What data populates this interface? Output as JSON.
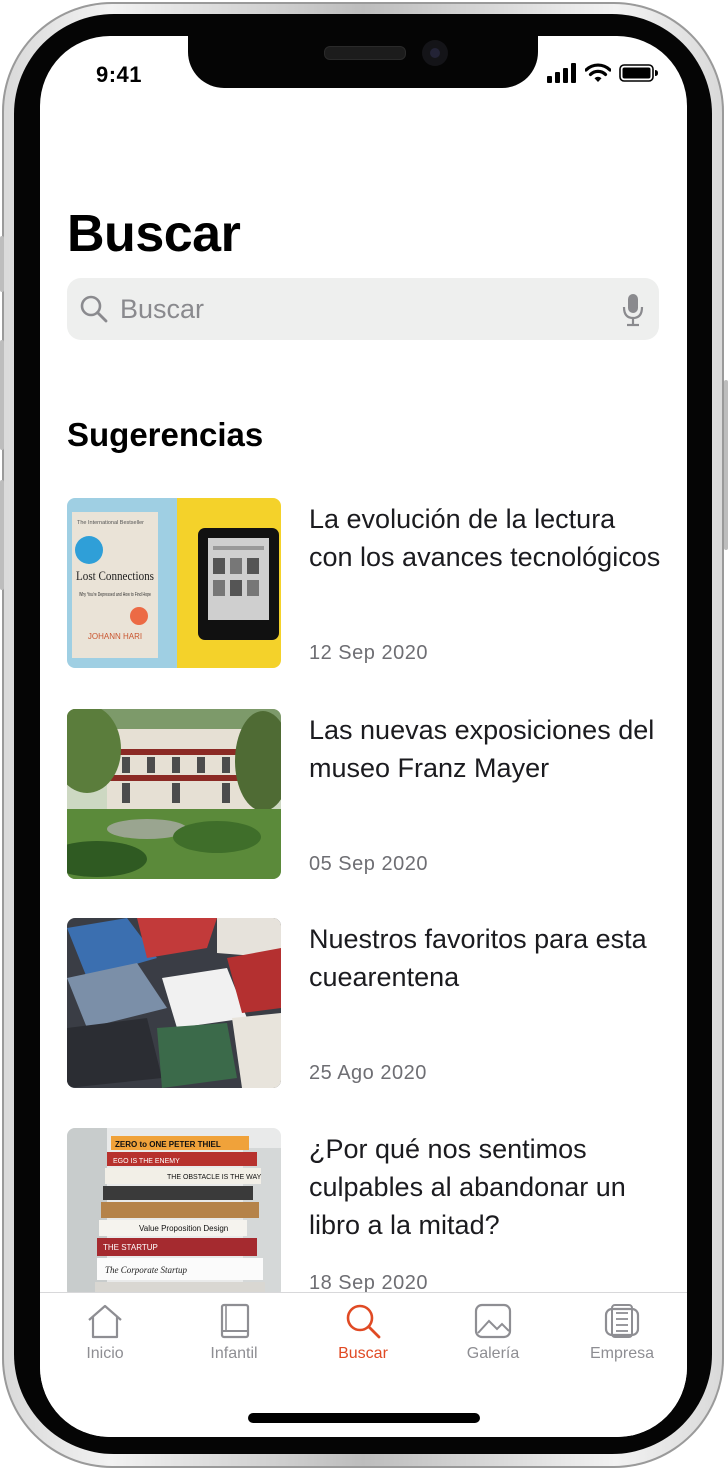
{
  "status_bar": {
    "time": "9:41"
  },
  "page_title": "Buscar",
  "search": {
    "placeholder": "Buscar"
  },
  "section_title": "Sugerencias",
  "articles": [
    {
      "title": "La evolución de la lectura con los avances tecnológicos",
      "date": "12 Sep 2020",
      "image": "book-and-ereader"
    },
    {
      "title": "Las nuevas exposiciones del museo Franz Mayer",
      "date": "05 Sep 2020",
      "image": "museum-courtyard"
    },
    {
      "title": "Nuestros favoritos para esta cuearentena",
      "date": "25 Ago 2020",
      "image": "books-on-table"
    },
    {
      "title": "¿Por qué nos sentimos culpables al abandonar un libro a la mitad?",
      "date": "18 Sep 2020",
      "image": "book-stack"
    }
  ],
  "image_text": {
    "cover_kicker": "The International Bestseller",
    "cover_title": "Lost Connections",
    "cover_subtitle": "Why You're Depressed and How to Find Hope",
    "cover_author": "JOHANN HARI",
    "spine_1": "ZERO to ONE  PETER THIEL",
    "spine_2": "EGO IS THE ENEMY",
    "spine_3": "THE OBSTACLE IS THE WAY",
    "spine_4": "Value Proposition Design",
    "spine_5": "THE STARTUP",
    "spine_6": "The Corporate Startup"
  },
  "tabs": [
    {
      "label": "Inicio",
      "icon": "home-icon",
      "active": false
    },
    {
      "label": "Infantil",
      "icon": "book-icon",
      "active": false
    },
    {
      "label": "Buscar",
      "icon": "search-icon",
      "active": true
    },
    {
      "label": "Galería",
      "icon": "gallery-icon",
      "active": false
    },
    {
      "label": "Empresa",
      "icon": "building-icon",
      "active": false
    }
  ],
  "colors": {
    "accent": "#e04a24",
    "inactive": "#8e8e93",
    "search_bg": "#eeefee"
  }
}
